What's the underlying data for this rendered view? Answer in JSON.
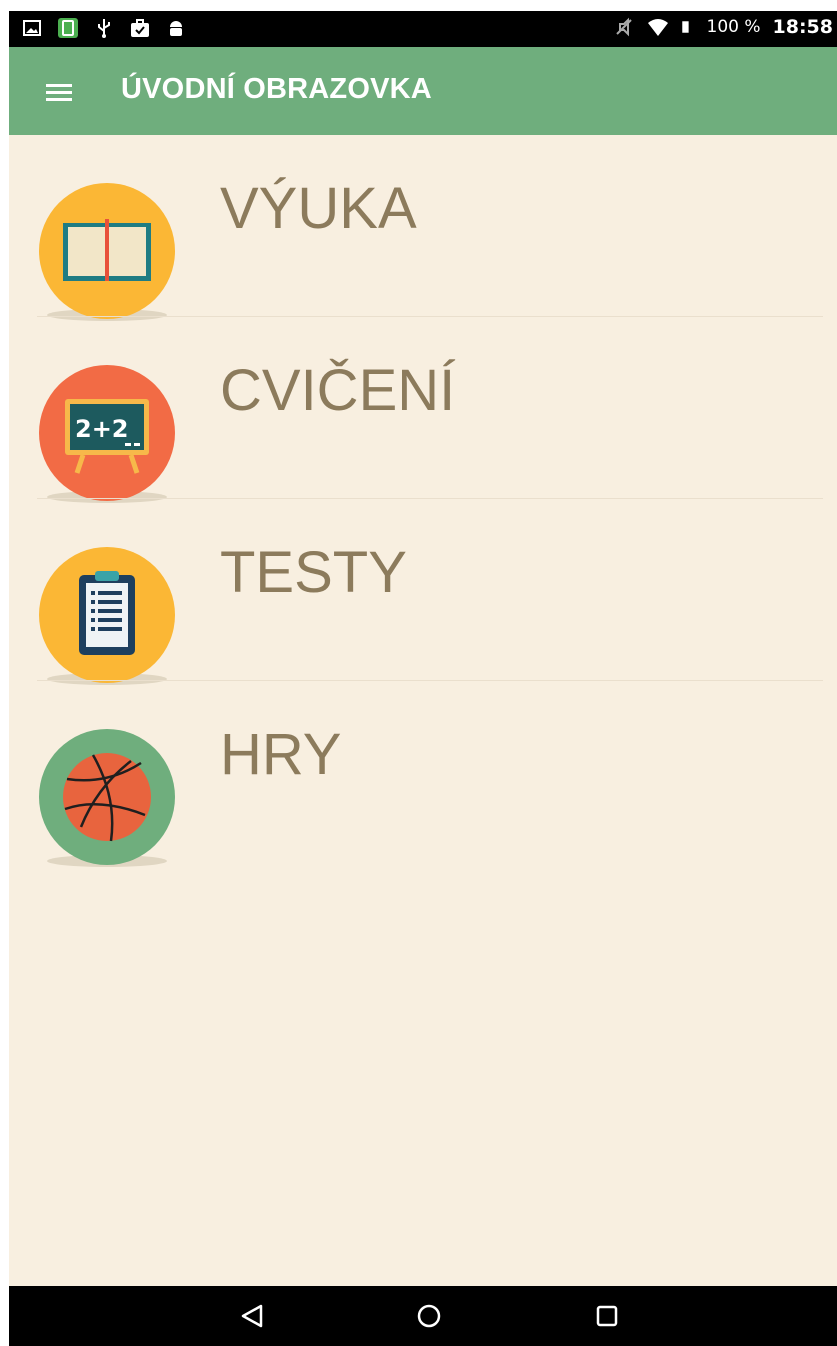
{
  "status_bar": {
    "left_icons": [
      "gallery-icon",
      "screen-app-icon",
      "usb-icon",
      "briefcase-check-icon",
      "android-icon"
    ],
    "right_icons": [
      "mute-icon",
      "wifi-icon",
      "battery-icon"
    ],
    "battery_text": "100 %",
    "time": "18:58"
  },
  "app_bar": {
    "menu_icon": "hamburger-menu-icon",
    "title": "ÚVODNÍ OBRAZOVKA",
    "color": "#6fae7d"
  },
  "menu": {
    "items": [
      {
        "label": "VÝUKA",
        "icon": "open-book-icon",
        "circle_color": "#fbb735"
      },
      {
        "label": "CVIČENÍ",
        "icon": "chalkboard-icon",
        "circle_color": "#f26b45"
      },
      {
        "label": "TESTY",
        "icon": "clipboard-icon",
        "circle_color": "#fbb735"
      },
      {
        "label": "HRY",
        "icon": "basketball-icon",
        "circle_color": "#6fae7d"
      }
    ]
  },
  "nav_bar": {
    "buttons": [
      "back-icon",
      "home-icon",
      "recents-icon"
    ]
  },
  "colors": {
    "background": "#f8efe0",
    "label_text": "#8c7b5c"
  }
}
